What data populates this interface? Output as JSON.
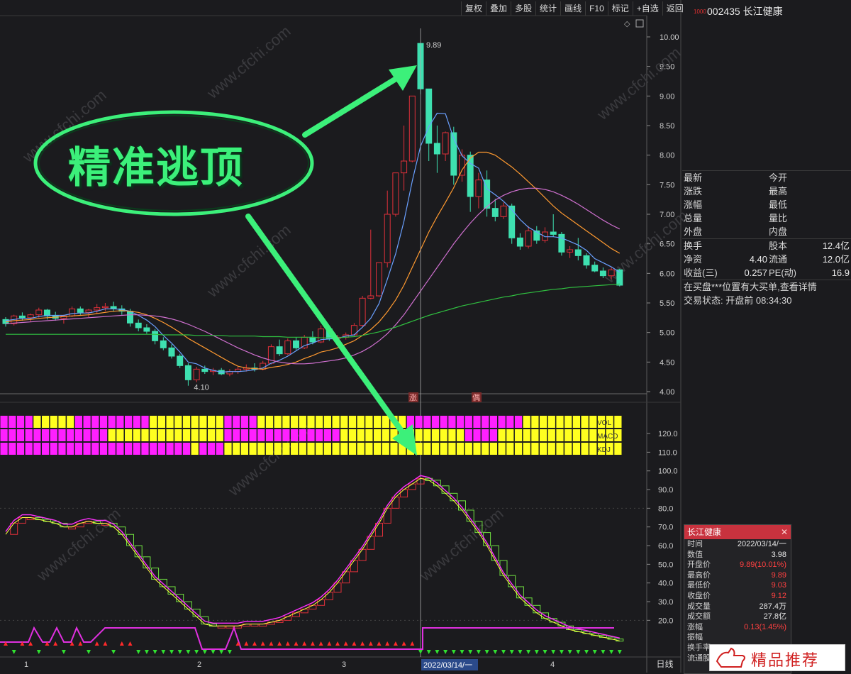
{
  "toolbar": {
    "items": [
      "复权",
      "叠加",
      "多股",
      "统计",
      "画线",
      "F10",
      "标记",
      "+自选",
      "返回"
    ]
  },
  "stock": {
    "badge": "1000",
    "code_name": "002435 长江健康"
  },
  "price_axis": [
    "10.00",
    "9.50",
    "9.00",
    "8.50",
    "8.00",
    "7.50",
    "7.00",
    "6.50",
    "6.00",
    "5.50",
    "5.00",
    "4.50",
    "4.00"
  ],
  "price_ylim": [
    3.9,
    10.2
  ],
  "indicator_axis": [
    "120.0",
    "110.0",
    "100.0",
    "90.0",
    "80.0",
    "70.0",
    "60.0",
    "50.0",
    "40.0",
    "30.0",
    "20.0"
  ],
  "annotations": {
    "high_label": "9.89",
    "low_label": "4.10",
    "marker_zhang": "涨",
    "marker_ding": "偶",
    "callout": "精准逃顶",
    "signal_rows": [
      "VOL",
      "MACD",
      "KDJ"
    ]
  },
  "x_axis": {
    "labels": [
      "1",
      "2",
      "3",
      "4"
    ],
    "cursor_date": "2022/03/14/一",
    "period_button": "日线"
  },
  "quote": {
    "rows1": [
      {
        "l": "最新",
        "r": "今开"
      },
      {
        "l": "涨跌",
        "r": "最高"
      },
      {
        "l": "涨幅",
        "r": "最低"
      },
      {
        "l": "总量",
        "r": "量比"
      },
      {
        "l": "外盘",
        "r": "内盘"
      }
    ],
    "rows2": [
      {
        "l": "换手",
        "v": "",
        "r": "股本",
        "v2": "12.4亿"
      },
      {
        "l": "净资",
        "v": "4.40",
        "r": "流通",
        "v2": "12.0亿"
      },
      {
        "l": "收益(三)",
        "v": "0.257",
        "r": "PE(动)",
        "v2": "16.9"
      }
    ],
    "notice": "在买盘***位置有大买单,查看详情",
    "status": "交易状态: 开盘前 08:34:30"
  },
  "popup": {
    "title": "长江健康",
    "close": "✕",
    "rows": [
      {
        "l": "时间",
        "v": "2022/03/14/一",
        "red": false
      },
      {
        "l": "数值",
        "v": "3.98",
        "red": false
      },
      {
        "l": "开盘价",
        "v": "9.89(10.01%)",
        "red": true
      },
      {
        "l": "最高价",
        "v": "9.89",
        "red": true
      },
      {
        "l": "最低价",
        "v": "9.03",
        "red": true
      },
      {
        "l": "收盘价",
        "v": "9.12",
        "red": true
      },
      {
        "l": "成交量",
        "v": "287.4万",
        "red": false
      },
      {
        "l": "成交额",
        "v": "27.8亿",
        "red": false
      },
      {
        "l": "涨幅",
        "v": "0.13(1.45%)",
        "red": true
      },
      {
        "l": "振幅",
        "v": "",
        "red": false
      },
      {
        "l": "换手率",
        "v": "",
        "red": false
      },
      {
        "l": "流通股",
        "v": "",
        "red": false
      }
    ]
  },
  "watermark": {
    "site": "www.cfchi.com",
    "badge_text": "精品推荐"
  },
  "colors": {
    "up": "#e0303a",
    "down": "#3ee0b0",
    "ma5": "#6aa0ff",
    "ma10": "#ff9a30",
    "ma20": "#d070d0",
    "ma60": "#30c040",
    "signal_pink": "#ff20ff",
    "signal_yellow": "#ffff20",
    "callout": "#3cf07a"
  },
  "chart_data": {
    "type": "candlestick",
    "candles": [
      [
        5.22,
        5.26,
        5.1,
        5.15
      ],
      [
        5.15,
        5.3,
        5.12,
        5.28
      ],
      [
        5.28,
        5.34,
        5.2,
        5.25
      ],
      [
        5.25,
        5.32,
        5.18,
        5.3
      ],
      [
        5.3,
        5.42,
        5.25,
        5.38
      ],
      [
        5.38,
        5.4,
        5.22,
        5.28
      ],
      [
        5.28,
        5.35,
        5.2,
        5.24
      ],
      [
        5.24,
        5.3,
        5.15,
        5.28
      ],
      [
        5.28,
        5.44,
        5.26,
        5.4
      ],
      [
        5.4,
        5.44,
        5.3,
        5.34
      ],
      [
        5.34,
        5.4,
        5.26,
        5.38
      ],
      [
        5.38,
        5.48,
        5.32,
        5.42
      ],
      [
        5.42,
        5.5,
        5.36,
        5.44
      ],
      [
        5.44,
        5.52,
        5.35,
        5.4
      ],
      [
        5.4,
        5.46,
        5.3,
        5.36
      ],
      [
        5.36,
        5.4,
        5.1,
        5.16
      ],
      [
        5.16,
        5.22,
        5.02,
        5.08
      ],
      [
        5.08,
        5.14,
        4.98,
        5.02
      ],
      [
        5.02,
        5.06,
        4.8,
        4.86
      ],
      [
        4.86,
        4.92,
        4.7,
        4.74
      ],
      [
        4.74,
        4.8,
        4.56,
        4.6
      ],
      [
        4.6,
        4.64,
        4.4,
        4.44
      ],
      [
        4.44,
        4.48,
        4.1,
        4.2
      ],
      [
        4.2,
        4.42,
        4.16,
        4.38
      ],
      [
        4.38,
        4.44,
        4.3,
        4.34
      ],
      [
        4.34,
        4.4,
        4.28,
        4.36
      ],
      [
        4.36,
        4.4,
        4.28,
        4.3
      ],
      [
        4.3,
        4.38,
        4.26,
        4.34
      ],
      [
        4.34,
        4.42,
        4.3,
        4.38
      ],
      [
        4.38,
        4.46,
        4.34,
        4.4
      ],
      [
        4.4,
        4.48,
        4.34,
        4.38
      ],
      [
        4.38,
        4.52,
        4.36,
        4.48
      ],
      [
        4.48,
        4.8,
        4.46,
        4.76
      ],
      [
        4.76,
        4.88,
        4.6,
        4.64
      ],
      [
        4.64,
        4.9,
        4.62,
        4.86
      ],
      [
        4.86,
        4.92,
        4.7,
        4.74
      ],
      [
        4.74,
        4.96,
        4.72,
        4.92
      ],
      [
        4.92,
        5.02,
        4.8,
        4.84
      ],
      [
        4.84,
        5.12,
        4.82,
        5.06
      ],
      [
        5.06,
        5.1,
        4.86,
        4.9
      ],
      [
        4.9,
        4.96,
        4.86,
        4.92
      ],
      [
        4.92,
        5.0,
        4.88,
        4.96
      ],
      [
        4.96,
        5.16,
        4.94,
        5.12
      ],
      [
        5.12,
        5.62,
        5.1,
        5.58
      ],
      [
        5.58,
        6.74,
        5.56,
        5.62
      ],
      [
        5.62,
        6.18,
        5.6,
        6.18
      ],
      [
        6.18,
        7.4,
        6.1,
        7.0
      ],
      [
        7.0,
        7.7,
        6.96,
        7.7
      ],
      [
        7.7,
        8.5,
        7.4,
        7.9
      ],
      [
        7.9,
        9.0,
        7.88,
        9.0
      ],
      [
        9.89,
        9.89,
        9.03,
        9.12
      ],
      [
        9.12,
        9.12,
        7.9,
        8.2
      ],
      [
        8.2,
        8.5,
        7.7,
        8.02
      ],
      [
        8.02,
        8.4,
        7.9,
        8.38
      ],
      [
        8.38,
        8.48,
        7.5,
        7.66
      ],
      [
        7.66,
        8.1,
        7.55,
        8.0
      ],
      [
        8.0,
        8.06,
        7.04,
        7.3
      ],
      [
        7.3,
        7.7,
        7.1,
        7.58
      ],
      [
        7.58,
        7.74,
        6.96,
        7.1
      ],
      [
        7.1,
        7.26,
        6.88,
        6.96
      ],
      [
        6.96,
        7.2,
        6.92,
        7.14
      ],
      [
        7.14,
        7.18,
        6.5,
        6.6
      ],
      [
        6.6,
        6.68,
        6.4,
        6.46
      ],
      [
        6.46,
        6.8,
        6.42,
        6.72
      ],
      [
        6.72,
        6.8,
        6.5,
        6.56
      ],
      [
        6.56,
        6.78,
        6.52,
        6.7
      ],
      [
        6.7,
        7.0,
        6.62,
        6.66
      ],
      [
        6.66,
        6.7,
        6.3,
        6.36
      ],
      [
        6.36,
        6.46,
        6.26,
        6.4
      ],
      [
        6.4,
        6.6,
        6.22,
        6.3
      ],
      [
        6.3,
        6.34,
        6.08,
        6.14
      ],
      [
        6.14,
        6.2,
        6.02,
        6.04
      ],
      [
        6.04,
        6.1,
        5.92,
        5.96
      ],
      [
        5.96,
        6.1,
        5.9,
        6.06
      ],
      [
        6.06,
        6.08,
        5.78,
        5.8
      ]
    ],
    "ma_series": [
      {
        "name": "MA5",
        "values": [
          5.2,
          5.22,
          5.24,
          5.24,
          5.27,
          5.29,
          5.29,
          5.29,
          5.32,
          5.33,
          5.33,
          5.36,
          5.4,
          5.4,
          5.39,
          5.36,
          5.29,
          5.21,
          5.1,
          4.95,
          4.82,
          4.67,
          4.5,
          4.47,
          4.4,
          4.36,
          4.33,
          4.34,
          4.34,
          4.35,
          4.37,
          4.4,
          4.48,
          4.53,
          4.6,
          4.69,
          4.78,
          4.82,
          4.88,
          4.89,
          4.9,
          4.94,
          4.96,
          5.09,
          5.24,
          5.49,
          5.9,
          6.33,
          6.88,
          7.56,
          8.15,
          8.48,
          8.71,
          8.7,
          8.28,
          7.99,
          7.86,
          7.78,
          7.43,
          7.33,
          7.22,
          7.08,
          6.91,
          6.78,
          6.7,
          6.62,
          6.62,
          6.6,
          6.54,
          6.48,
          6.39,
          6.25,
          6.18,
          6.11,
          6.02
        ]
      },
      {
        "name": "MA10",
        "values": [
          5.18,
          5.2,
          5.21,
          5.22,
          5.24,
          5.25,
          5.26,
          5.27,
          5.28,
          5.29,
          5.3,
          5.32,
          5.34,
          5.36,
          5.37,
          5.36,
          5.34,
          5.3,
          5.24,
          5.17,
          5.09,
          5.0,
          4.9,
          4.82,
          4.74,
          4.66,
          4.58,
          4.5,
          4.43,
          4.4,
          4.39,
          4.38,
          4.41,
          4.43,
          4.46,
          4.5,
          4.56,
          4.61,
          4.67,
          4.7,
          4.74,
          4.8,
          4.86,
          4.95,
          5.05,
          5.18,
          5.35,
          5.55,
          5.8,
          6.1,
          6.4,
          6.7,
          6.96,
          7.2,
          7.45,
          7.75,
          7.95,
          8.05,
          8.05,
          8.0,
          7.9,
          7.8,
          7.68,
          7.55,
          7.42,
          7.28,
          7.14,
          7.02,
          6.92,
          6.82,
          6.72,
          6.62,
          6.52,
          6.42,
          6.34
        ]
      },
      {
        "name": "MA20",
        "values": [
          5.15,
          5.16,
          5.17,
          5.18,
          5.19,
          5.2,
          5.21,
          5.22,
          5.23,
          5.24,
          5.25,
          5.26,
          5.27,
          5.28,
          5.29,
          5.3,
          5.3,
          5.29,
          5.28,
          5.26,
          5.23,
          5.19,
          5.14,
          5.08,
          5.02,
          4.95,
          4.88,
          4.81,
          4.74,
          4.68,
          4.62,
          4.57,
          4.53,
          4.5,
          4.48,
          4.47,
          4.47,
          4.48,
          4.5,
          4.52,
          4.54,
          4.57,
          4.62,
          4.68,
          4.76,
          4.86,
          4.98,
          5.13,
          5.3,
          5.5,
          5.7,
          5.9,
          6.1,
          6.3,
          6.5,
          6.68,
          6.85,
          7.0,
          7.13,
          7.24,
          7.32,
          7.38,
          7.42,
          7.44,
          7.44,
          7.42,
          7.38,
          7.32,
          7.25,
          7.17,
          7.08,
          6.99,
          6.9,
          6.82,
          6.75
        ]
      },
      {
        "name": "MA60",
        "values": [
          4.97,
          4.97,
          4.97,
          4.97,
          4.97,
          4.97,
          4.97,
          4.97,
          4.97,
          4.97,
          4.97,
          4.97,
          4.97,
          4.97,
          4.97,
          4.97,
          4.97,
          4.97,
          4.97,
          4.96,
          4.96,
          4.96,
          4.96,
          4.95,
          4.95,
          4.95,
          4.95,
          4.94,
          4.94,
          4.94,
          4.94,
          4.93,
          4.93,
          4.93,
          4.92,
          4.92,
          4.92,
          4.92,
          4.91,
          4.91,
          4.91,
          4.92,
          4.93,
          4.95,
          4.98,
          5.01,
          5.05,
          5.09,
          5.14,
          5.19,
          5.24,
          5.29,
          5.33,
          5.37,
          5.41,
          5.45,
          5.48,
          5.51,
          5.54,
          5.57,
          5.6,
          5.62,
          5.65,
          5.67,
          5.69,
          5.71,
          5.73,
          5.74,
          5.76,
          5.77,
          5.78,
          5.79,
          5.8,
          5.81,
          5.82
        ]
      }
    ],
    "signals": {
      "VOL": "PPPPYYYYYPPPPPPPPPYYYYYYYYYPPPPYYYYYYYYYYYYYYYYYYPPPPPPPPPPPPPPYYYYYYYYYYYYYYYY",
      "MACD": "PPPPPPPPPPPPPYYYYYYYYYYYYYYPPPPPPPPPPPPPPYYYYYYYYYYYYYYYPPPPYYYYYYYYYYYYYYYYYYY",
      "KDJ": "PPPPPPPPPPPPPPPPPPPPPPPYPPPYYYYYYYYYYYYYYYYYYYYYYYYYYYYYYYYYYYYYYYYYYYYYYYYYYPY"
    },
    "indicator": [
      66,
      72,
      75,
      75,
      74,
      73,
      72,
      70,
      70,
      72,
      73,
      72,
      72,
      70,
      66,
      60,
      54,
      48,
      42,
      38,
      34,
      30,
      26,
      22,
      18,
      17,
      17,
      17,
      17,
      18,
      18,
      18,
      19,
      20,
      22,
      24,
      26,
      28,
      31,
      35,
      40,
      46,
      52,
      58,
      65,
      72,
      80,
      86,
      90,
      93,
      96,
      95,
      92,
      88,
      84,
      79,
      73,
      67,
      60,
      52,
      44,
      38,
      32,
      28,
      24,
      21,
      19,
      17,
      15,
      14,
      13,
      12,
      11,
      10,
      9
    ],
    "indicator_ylim": [
      0,
      128
    ]
  }
}
